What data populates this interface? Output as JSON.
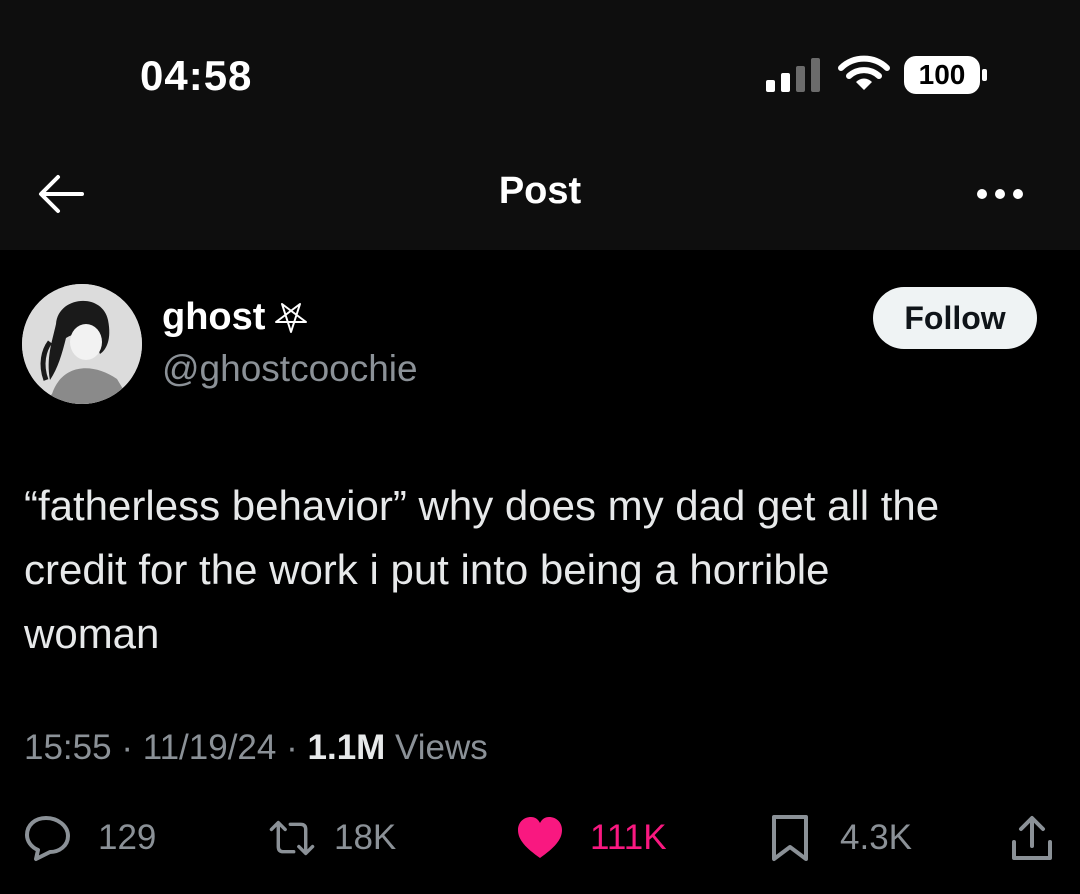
{
  "status_bar": {
    "time": "04:58",
    "battery": "100"
  },
  "nav": {
    "title": "Post"
  },
  "author": {
    "name": "ghost",
    "handle": "@ghostcoochie"
  },
  "follow_label": "Follow",
  "post": {
    "text": "“fatherless behavior” why does my dad get all the\ncredit for the work i put into being a horrible\nwoman",
    "time": "15:55",
    "date": "11/19/24",
    "views_count": "1.1M",
    "views_label": "Views"
  },
  "actions": {
    "replies": "129",
    "reposts": "18K",
    "likes": "111K",
    "bookmarks": "4.3K"
  },
  "colors": {
    "like": "#f91880",
    "muted": "#8b9197",
    "text": "#e7e9ea",
    "bg": "#000000"
  }
}
